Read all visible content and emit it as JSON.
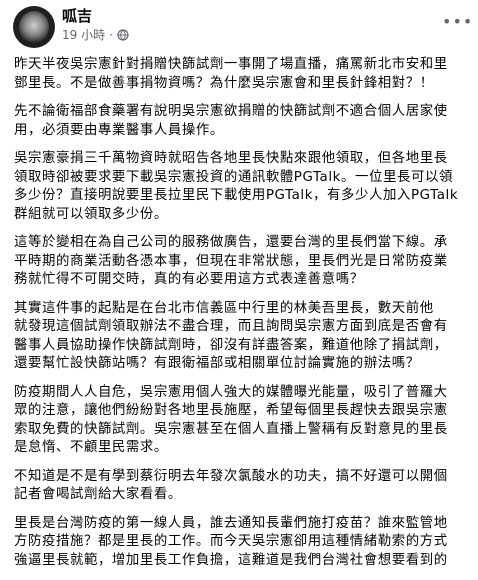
{
  "post": {
    "author": "呱吉",
    "time": "19 小時",
    "visibility_icon": "globe-icon",
    "more_icon": "more-options-icon",
    "paragraphs": [
      "昨天半夜吳宗憲針對捐贈快篩試劑一事開了場直播，痛罵新北市安和里\n鄧里長。不是做善事捐物資嗎？為什麼吳宗憲會和里長針鋒相對？！",
      "先不論衛福部食藥署有說明吳宗憲欲捐贈的快篩試劑不適合個人居家使\n用，必須要由專業醫事人員操作。",
      "吳宗憲豪捐三千萬物資時就昭告各地里長快點來跟他領取，但各地里長\n領取時卻被要求要下載吳宗憲投資的通訊軟體PGTalk。一位里長可以領\n多少份？直接明說要里長拉里民下載使用PGTalk，有多少人加入PGTalk\n群組就可以領取多少份。",
      "這等於變相在為自己公司的服務做廣告，還要台灣的里長們當下線。承\n平時期的商業活動各憑本事，但現在非常狀態，里長們光是日常防疫業\n務就忙得不可開交時，真的有必要用這方式表達善意嗎？",
      "其實這件事的起點是在台北市信義區中行里的林美吾里長，數天前他\n就發現這個試劑領取辦法不盡合理，而且詢問吳宗憲方面到底是否會有\n醫事人員協助操作快篩試劑時，卻沒有詳盡答案，難道他除了捐試劑，\n還要幫忙設快篩站嗎？有跟衛福部或相關單位討論實施的辦法嗎？",
      "防疫期間人人自危，吳宗憲用個人強大的媒體曝光能量，吸引了普羅大\n眾的注意，讓他們紛紛對各地里長施壓，希望每個里長趕快去跟吳宗憲\n索取免費的快篩試劑。吳宗憲甚至在個人直播上警稱有反對意見的里長\n是怠惰、不顧里民需求。",
      "不知道是不是有學到蔡衍明去年發次氯酸水的功夫，搞不好還可以開個\n記者會喝試劑給大家看看。",
      "里長是台灣防疫的第一線人員，誰去通知長輩們施打疫苗？誰來監管地\n方防疫措施？都是里長的工作。而今天吳宗憲卻用這種情緒勒索的方式\n強逼里長就範，增加里長工作負擔，這難道是我們台灣社會想要看到的"
    ]
  }
}
